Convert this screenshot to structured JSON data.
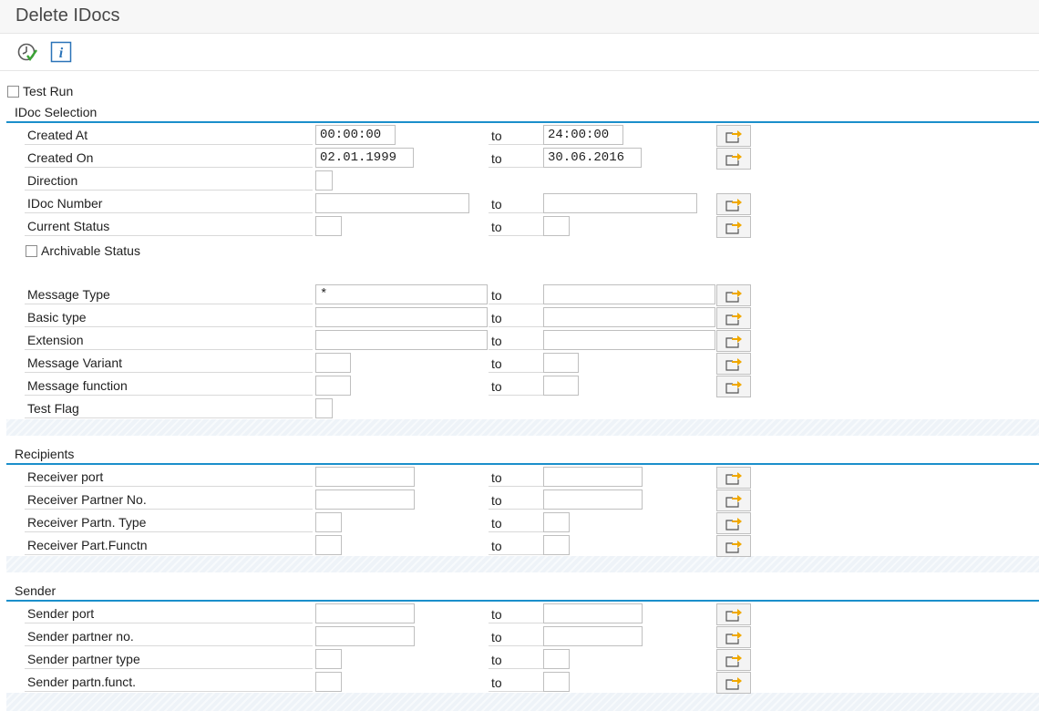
{
  "window": {
    "title": "Delete IDocs"
  },
  "toolbar": {
    "execute_icon": "execute-clock-icon",
    "info_icon": "info-icon"
  },
  "test_run": {
    "label": "Test Run",
    "checked": false
  },
  "to_label": "to",
  "idoc_selection": {
    "title": "IDoc Selection",
    "created_at": {
      "label": "Created At",
      "from": "00:00:00",
      "to": "24:00:00"
    },
    "created_on": {
      "label": "Created On",
      "from": "02.01.1999",
      "to": "30.06.2016"
    },
    "direction": {
      "label": "Direction",
      "value": ""
    },
    "idoc_number": {
      "label": "IDoc Number",
      "from": "",
      "to": ""
    },
    "current_status": {
      "label": "Current Status",
      "from": "",
      "to": ""
    },
    "archivable_status": {
      "label": "Archivable Status",
      "checked": false
    },
    "message_type": {
      "label": "Message Type",
      "from": "*",
      "to": ""
    },
    "basic_type": {
      "label": "Basic type",
      "from": "",
      "to": ""
    },
    "extension": {
      "label": "Extension",
      "from": "",
      "to": ""
    },
    "message_variant": {
      "label": "Message Variant",
      "from": "",
      "to": ""
    },
    "message_function": {
      "label": "Message function",
      "from": "",
      "to": ""
    },
    "test_flag": {
      "label": "Test Flag",
      "value": ""
    }
  },
  "recipients": {
    "title": "Recipients",
    "receiver_port": {
      "label": "Receiver port",
      "from": "",
      "to": ""
    },
    "receiver_partner_no": {
      "label": "Receiver Partner No.",
      "from": "",
      "to": ""
    },
    "receiver_partner_type": {
      "label": "Receiver Partn. Type",
      "from": "",
      "to": ""
    },
    "receiver_partner_function": {
      "label": "Receiver Part.Functn",
      "from": "",
      "to": ""
    }
  },
  "sender": {
    "title": "Sender",
    "sender_port": {
      "label": "Sender port",
      "from": "",
      "to": ""
    },
    "sender_partner_no": {
      "label": "Sender partner no.",
      "from": "",
      "to": ""
    },
    "sender_partner_type": {
      "label": "Sender partner type",
      "from": "",
      "to": ""
    },
    "sender_partner_function": {
      "label": "Sender partn.funct.",
      "from": "",
      "to": ""
    }
  },
  "multiple_selection_icon": "multiple-selection-arrow-icon",
  "colors": {
    "accent": "#1b8fcb",
    "arrow": "#f0a800"
  }
}
